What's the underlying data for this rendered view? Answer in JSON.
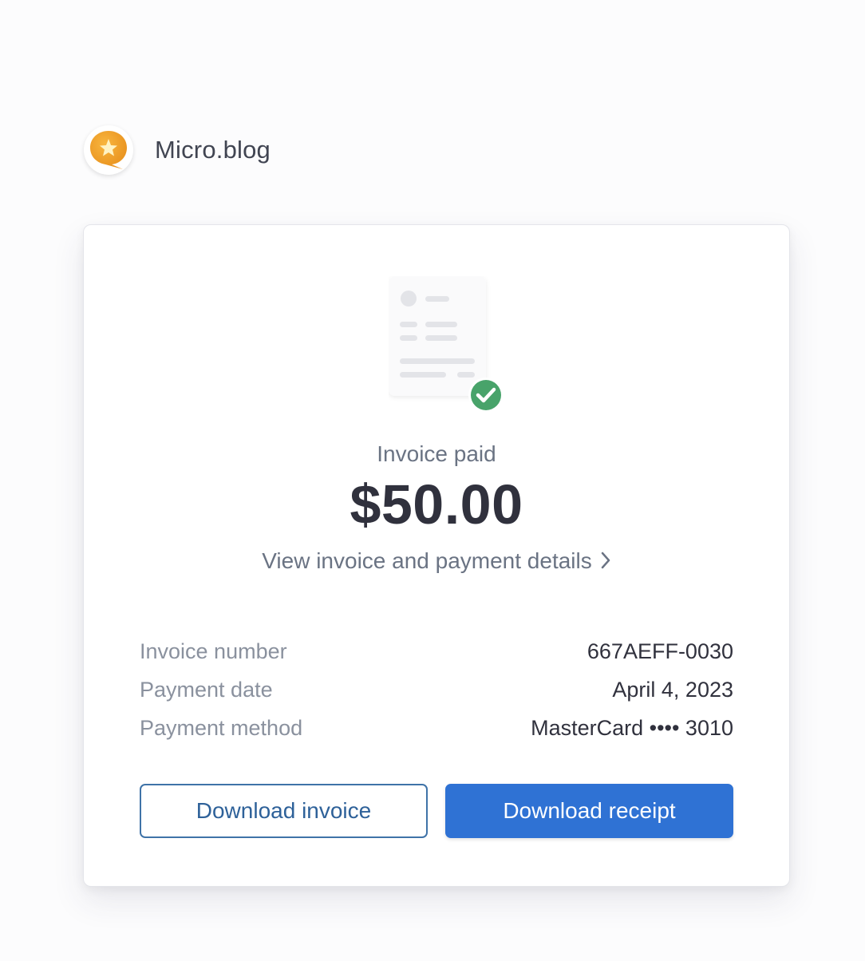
{
  "merchant": {
    "name": "Micro.blog",
    "logo_icon": "star-speech-bubble-icon"
  },
  "invoice": {
    "status": "Invoice paid",
    "amount": "$50.00",
    "details_link": "View invoice and payment details",
    "illustration_icon": "invoice-document-icon",
    "check_icon": "check-circle-icon",
    "check_color": "#48a36a"
  },
  "info": {
    "rows": [
      {
        "key": "Invoice number",
        "value": "667AEFF-0030"
      },
      {
        "key": "Payment date",
        "value": "April 4, 2023"
      },
      {
        "key": "Payment method",
        "value": "MasterCard •••• 3010"
      }
    ]
  },
  "buttons": {
    "download_invoice": "Download invoice",
    "download_receipt": "Download receipt"
  },
  "colors": {
    "primary": "#2f72d4",
    "logo_orange": "#f2a12b"
  }
}
